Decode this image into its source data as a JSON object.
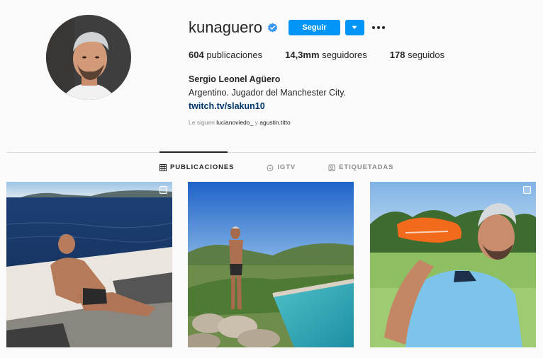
{
  "profile": {
    "username": "kunaguero",
    "follow_label": "Seguir",
    "stats": {
      "posts_count": "604",
      "posts_label": "publicaciones",
      "followers_count": "14,3mm",
      "followers_label": "seguidores",
      "following_count": "178",
      "following_label": "seguidos"
    },
    "full_name": "Sergio Leonel Agüero",
    "bio": "Argentino. Jugador del Manchester City.",
    "link": "twitch.tv/slakun10",
    "followed_by_prefix": "Le siguen",
    "followed_by_user1": "lucianoviedo_",
    "followed_by_joiner": "y",
    "followed_by_user2": "agustin.titto"
  },
  "tabs": [
    {
      "label": "PUBLICACIONES",
      "icon": "grid-icon",
      "active": true
    },
    {
      "label": "IGTV",
      "icon": "igtv-icon",
      "active": false
    },
    {
      "label": "ETIQUETADAS",
      "icon": "tagged-icon",
      "active": false
    }
  ],
  "posts": [
    {
      "scene": "man relaxing on boat deck at sea",
      "multi": true
    },
    {
      "scene": "man standing on rocks beside pool",
      "multi": false
    },
    {
      "scene": "man holding orange football boot in light blue shirt",
      "multi": true
    }
  ],
  "colors": {
    "accent": "#0095f6",
    "link": "#00376b",
    "muted": "#8e8e8e",
    "verified": "#3897f0"
  }
}
